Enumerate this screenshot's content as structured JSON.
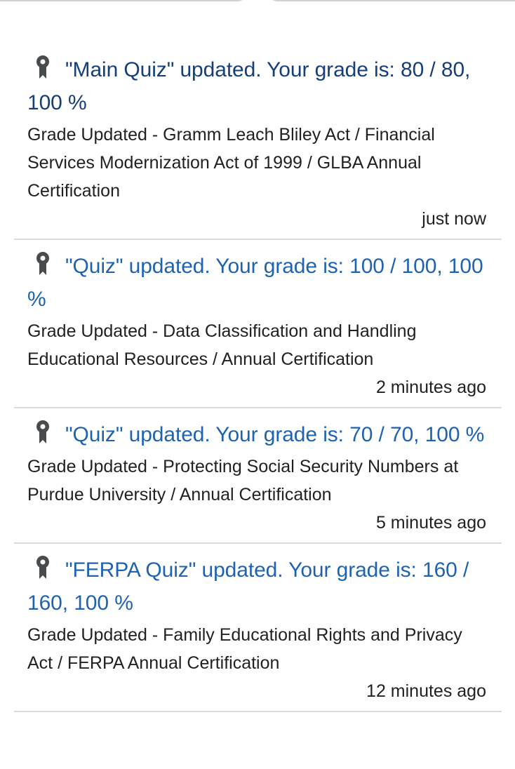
{
  "colors": {
    "link": "#1f63b0",
    "link_visited": "#163f7a",
    "text": "#202122",
    "divider": "#d8dadc"
  },
  "notifications": [
    {
      "icon": "award-ribbon-icon",
      "title": "\"Main Quiz\" updated. Your grade is: 80 / 80, 100 %",
      "description": "Grade Updated - Gramm Leach Bliley Act / Financial Services Modernization Act of 1999 / GLBA Annual Certification",
      "time": "just now",
      "visited": true
    },
    {
      "icon": "award-ribbon-icon",
      "title": "\"Quiz\" updated. Your grade is: 100 / 100, 100 %",
      "description": "Grade Updated - Data Classification and Handling Educational Resources / Annual Certification",
      "time": "2 minutes ago",
      "visited": false
    },
    {
      "icon": "award-ribbon-icon",
      "title": "\"Quiz\" updated. Your grade is: 70 / 70, 100 %",
      "description": "Grade Updated - Protecting Social Security Numbers at Purdue University / Annual Certification",
      "time": "5 minutes ago",
      "visited": false
    },
    {
      "icon": "award-ribbon-icon",
      "title": "\"FERPA Quiz\" updated. Your grade is: 160 / 160, 100 %",
      "description": "Grade Updated - Family Educational Rights and Privacy Act / FERPA Annual Certification",
      "time": "12 minutes ago",
      "visited": false
    }
  ]
}
